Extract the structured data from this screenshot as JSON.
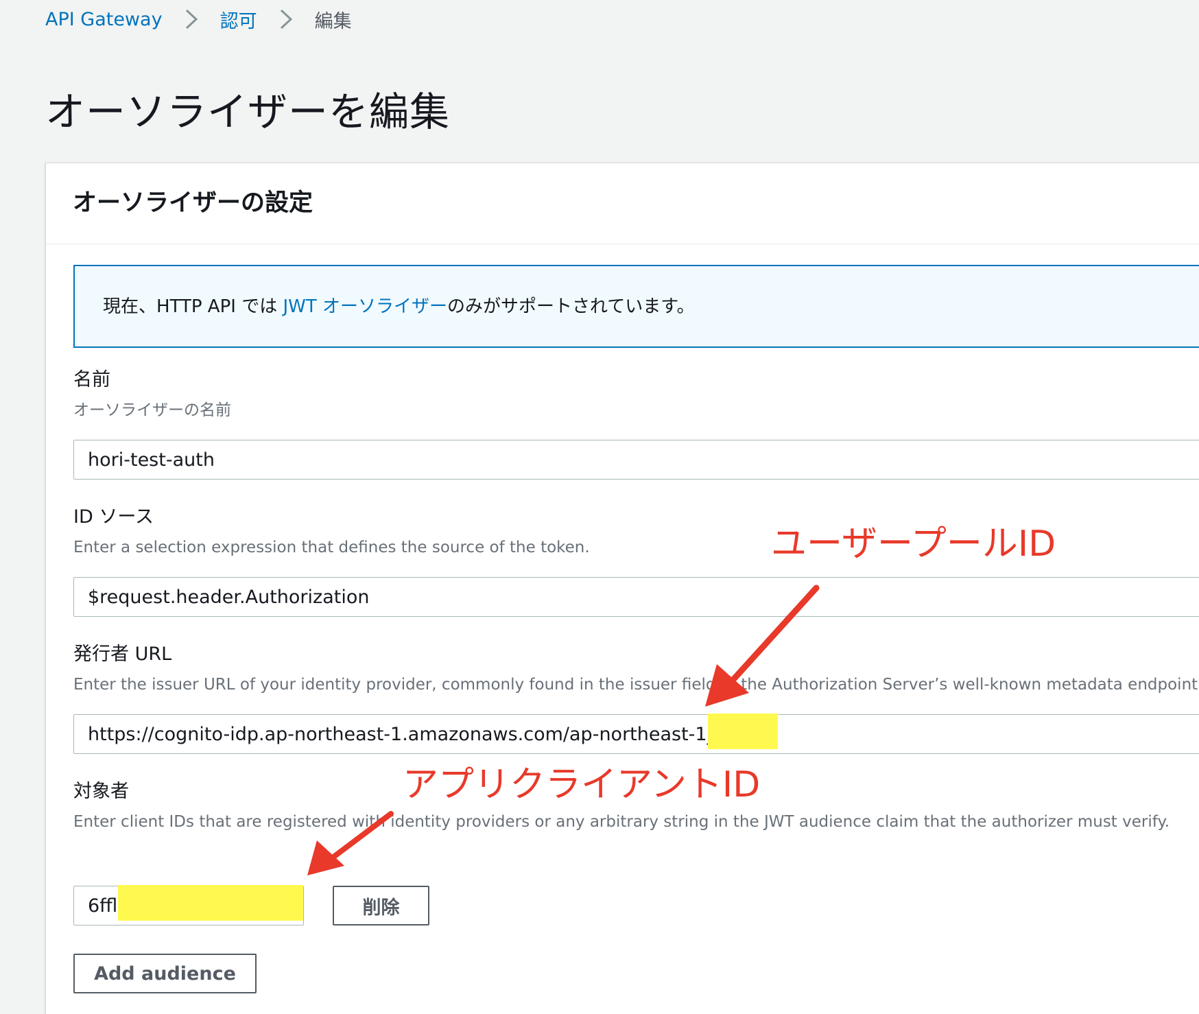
{
  "breadcrumb": {
    "items": [
      "API Gateway",
      "認可",
      "編集"
    ]
  },
  "page": {
    "title": "オーソライザーを編集"
  },
  "panel": {
    "title": "オーソライザーの設定",
    "info": {
      "prefix": "現在、HTTP API では ",
      "link": "JWT オーソライザー",
      "suffix": "のみがサポートされています。"
    },
    "name": {
      "label": "名前",
      "description": "オーソライザーの名前",
      "value": "hori-test-auth"
    },
    "identity_source": {
      "label": "ID ソース",
      "description": "Enter a selection expression that defines the source of the token.",
      "value": "$request.header.Authorization"
    },
    "issuer_url": {
      "label": "発行者 URL",
      "description": "Enter the issuer URL of your identity provider, commonly found in the issuer field of the Authorization Server’s well-known metadata endpoint.",
      "value": "https://cognito-idp.ap-northeast-1.amazonaws.com/ap-northeast-1_ItJ"
    },
    "audience": {
      "label": "対象者",
      "description": "Enter client IDs that are registered with identity providers or any arbitrary string in the JWT audience claim that the authorizer must verify.",
      "value": "6ffl",
      "remove_label": "削除",
      "add_label": "Add audience"
    }
  },
  "annotations": {
    "user_pool_id": "ユーザープールID",
    "app_client_id": "アプリクライアントID"
  },
  "colors": {
    "link": "#0073bb",
    "annotation": "#e8392a",
    "highlight": "#fff94f"
  }
}
